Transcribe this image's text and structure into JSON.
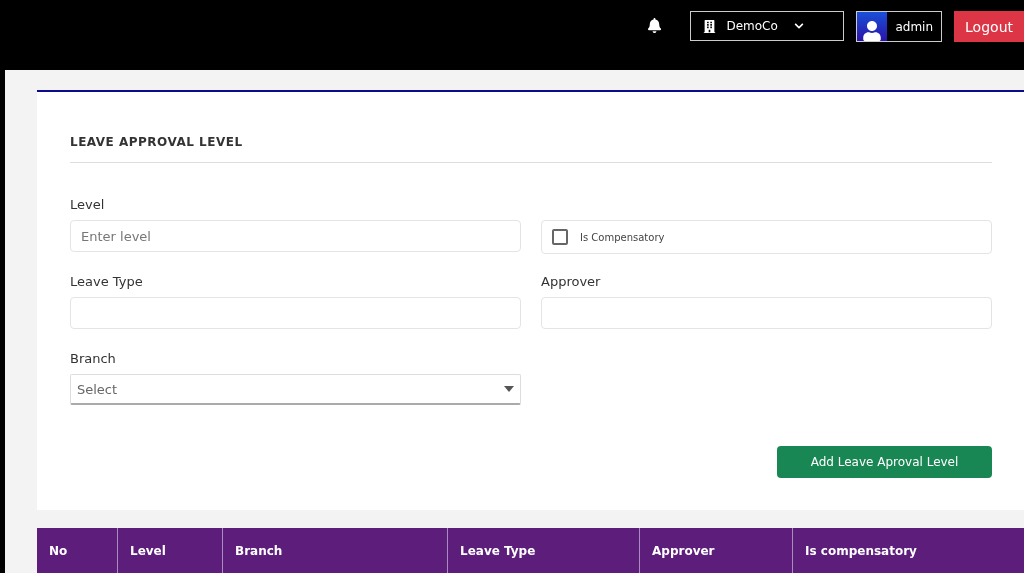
{
  "topbar": {
    "company": "DemoCo",
    "user": "admin",
    "logout": "Logout"
  },
  "form": {
    "title": "LEAVE APPROVAL LEVEL",
    "level": {
      "label": "Level",
      "placeholder": "Enter level"
    },
    "compensatory": {
      "label": "Is Compensatory",
      "checked": false
    },
    "leave_type": {
      "label": "Leave Type"
    },
    "approver": {
      "label": "Approver"
    },
    "branch": {
      "label": "Branch",
      "placeholder": "Select"
    },
    "submit": "Add Leave Aproval Level"
  },
  "table": {
    "columns": [
      "No",
      "Level",
      "Branch",
      "Leave Type",
      "Approver",
      "Is compensatory"
    ]
  }
}
